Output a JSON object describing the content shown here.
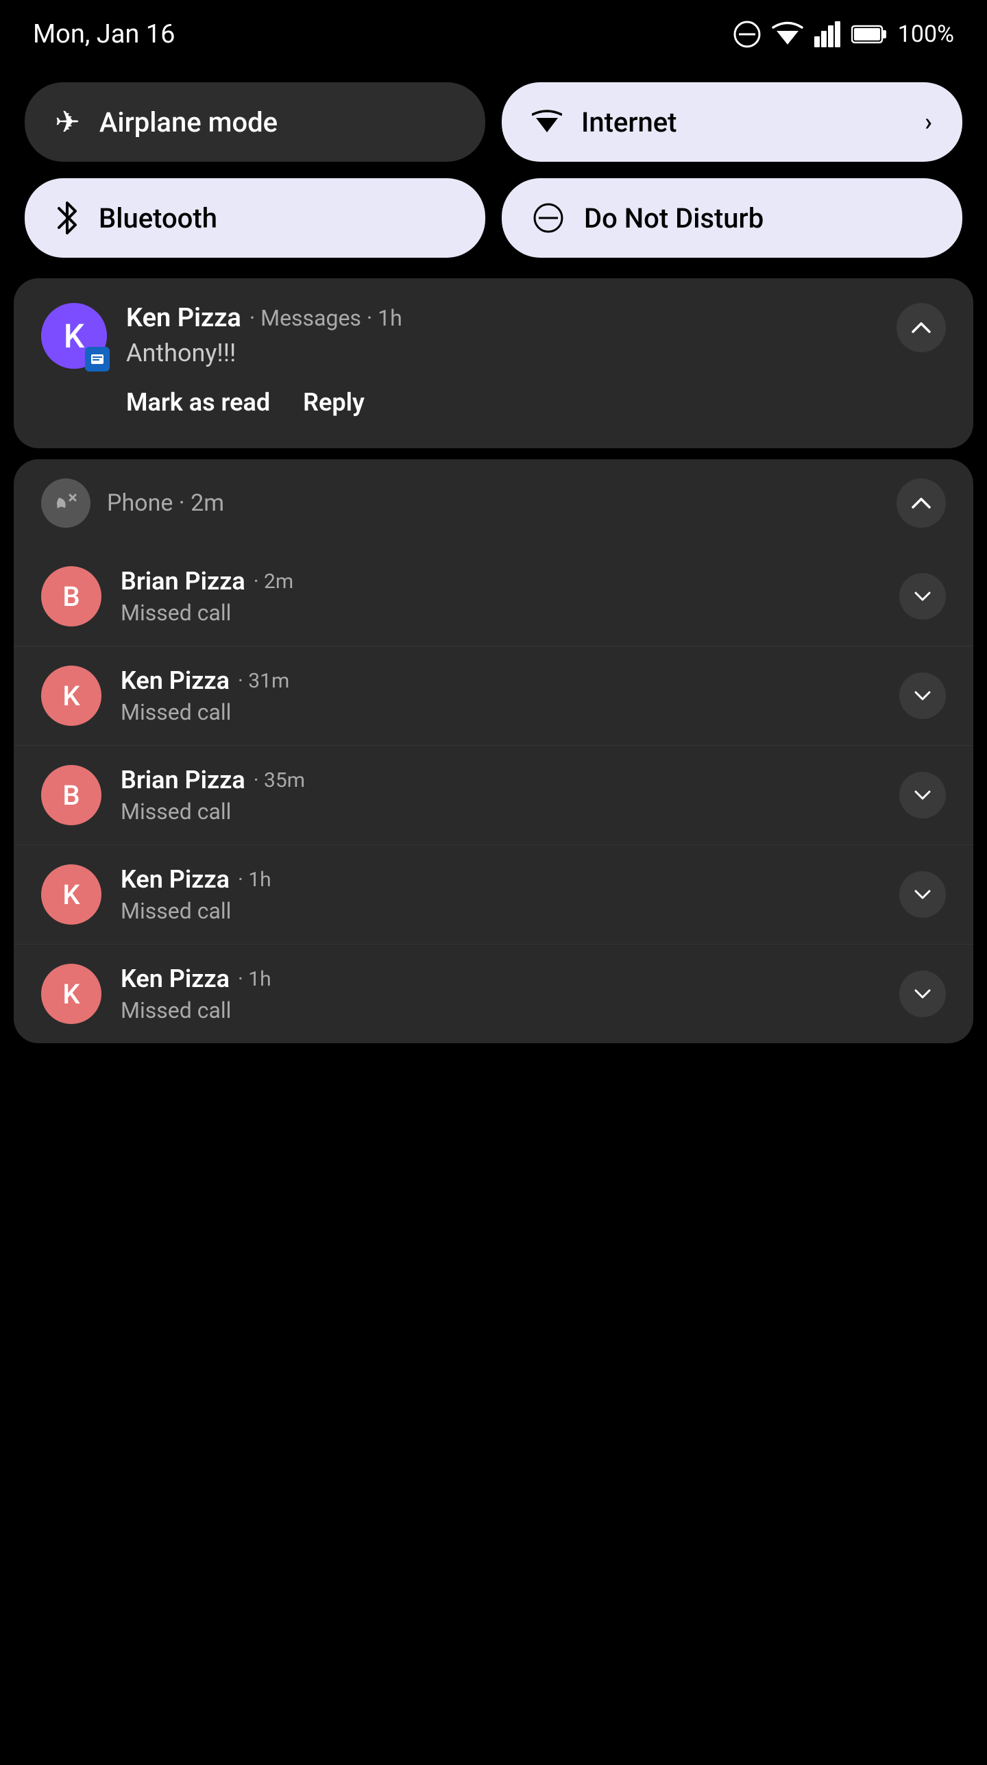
{
  "statusBar": {
    "time": "Mon, Jan 16",
    "battery": "100%",
    "batteryIcon": "battery-full-icon",
    "wifiIcon": "wifi-icon",
    "signalIcon": "signal-icon",
    "dndIcon": "dnd-icon"
  },
  "quickSettings": {
    "tiles": [
      {
        "id": "airplane-mode",
        "label": "Airplane mode",
        "icon": "✈",
        "style": "dark",
        "hasArrow": false
      },
      {
        "id": "internet",
        "label": "Internet",
        "icon": "wifi",
        "style": "light",
        "hasArrow": true
      },
      {
        "id": "bluetooth",
        "label": "Bluetooth",
        "icon": "bluetooth",
        "style": "light",
        "hasArrow": false
      },
      {
        "id": "do-not-disturb",
        "label": "Do Not Disturb",
        "icon": "dnd",
        "style": "light",
        "hasArrow": false
      }
    ]
  },
  "notifications": {
    "messages": {
      "sender": "Ken Pizza",
      "app": "Messages",
      "time": "1h",
      "message": "Anthony!!!",
      "avatarLetter": "K",
      "avatarColor": "#7c4dff",
      "actions": {
        "markAsRead": "Mark as read",
        "reply": "Reply"
      }
    },
    "phone": {
      "appName": "Phone",
      "time": "2m",
      "calls": [
        {
          "name": "Brian Pizza",
          "time": "2m",
          "status": "Missed call",
          "avatarLetter": "B",
          "avatarColor": "#e57373"
        },
        {
          "name": "Ken Pizza",
          "time": "31m",
          "status": "Missed call",
          "avatarLetter": "K",
          "avatarColor": "#e57373"
        },
        {
          "name": "Brian Pizza",
          "time": "35m",
          "status": "Missed call",
          "avatarLetter": "B",
          "avatarColor": "#e57373"
        },
        {
          "name": "Ken Pizza",
          "time": "1h",
          "status": "Missed call",
          "avatarLetter": "K",
          "avatarColor": "#e57373"
        },
        {
          "name": "Ken Pizza",
          "time": "1h",
          "status": "Missed call",
          "avatarLetter": "K",
          "avatarColor": "#e57373"
        }
      ]
    }
  }
}
